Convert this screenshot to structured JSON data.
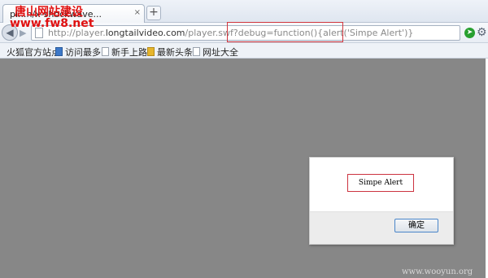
{
  "tab": {
    "title": "player.swf (application/x-shockwave-flash ...",
    "visible_text": "pl...n/x-shockwave...",
    "close": "×",
    "new_tab": "+"
  },
  "nav": {
    "url_prefix": "http://player.",
    "url_host": "longtailvideo.com",
    "url_suffix": "/player.swf?debug=function(){alert('Simpe Alert')}"
  },
  "bookmarks": [
    "火狐官方站点",
    "访问最多",
    "新手上路",
    "最新头条",
    "网址大全"
  ],
  "dialog": {
    "message": "Simpe Alert",
    "ok_label": "确定"
  },
  "watermarks": {
    "site_name": "唐山网站建设",
    "site_url": "www.fw8.net",
    "corner": "www.wooyun.org"
  },
  "colors": {
    "page_background": "#878787",
    "highlight_box": "#d0343c",
    "watermark": "#e01010"
  },
  "icons": {
    "back": "back-arrow-icon",
    "forward": "forward-arrow-icon",
    "page": "page-icon",
    "go": "go-arrow-icon",
    "menu": "gear-icon"
  }
}
